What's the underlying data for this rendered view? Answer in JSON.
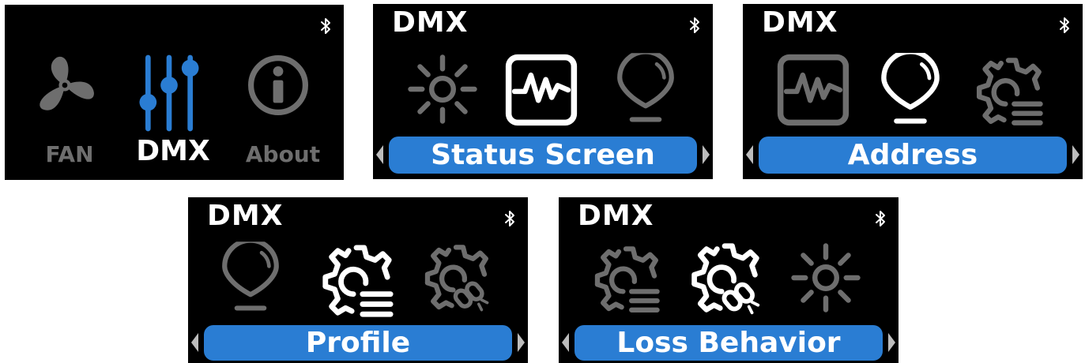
{
  "colors": {
    "accent": "#2a7dd3",
    "active": "#ffffff",
    "inactive": "#6e6e6e",
    "background": "#000000"
  },
  "screens": [
    {
      "header": "",
      "status_icon": "bluetooth-icon",
      "items": [
        {
          "icon": "fan-icon",
          "label": "FAN",
          "state": "inactive"
        },
        {
          "icon": "sliders-icon",
          "label": "DMX",
          "state": "selected"
        },
        {
          "icon": "info-icon",
          "label": "About",
          "state": "inactive"
        }
      ]
    },
    {
      "header": "DMX",
      "status_icon": "bluetooth-icon",
      "items": [
        {
          "icon": "brightness-icon",
          "state": "inactive"
        },
        {
          "icon": "status-monitor-icon",
          "state": "selected"
        },
        {
          "icon": "location-pin-icon",
          "state": "inactive"
        }
      ],
      "selected_label": "Status Screen"
    },
    {
      "header": "DMX",
      "status_icon": "bluetooth-icon",
      "items": [
        {
          "icon": "status-monitor-icon",
          "state": "inactive"
        },
        {
          "icon": "location-pin-icon",
          "state": "selected"
        },
        {
          "icon": "gear-list-icon",
          "state": "inactive"
        }
      ],
      "selected_label": "Address"
    },
    {
      "header": "DMX",
      "status_icon": "bluetooth-icon",
      "items": [
        {
          "icon": "location-pin-icon",
          "state": "inactive"
        },
        {
          "icon": "gear-list-icon",
          "state": "selected"
        },
        {
          "icon": "gear-broken-link-icon",
          "state": "inactive"
        }
      ],
      "selected_label": "Profile"
    },
    {
      "header": "DMX",
      "status_icon": "bluetooth-icon",
      "items": [
        {
          "icon": "gear-list-icon",
          "state": "inactive"
        },
        {
          "icon": "gear-broken-link-icon",
          "state": "selected"
        },
        {
          "icon": "brightness-icon",
          "state": "inactive"
        }
      ],
      "selected_label": "Loss Behavior"
    }
  ]
}
